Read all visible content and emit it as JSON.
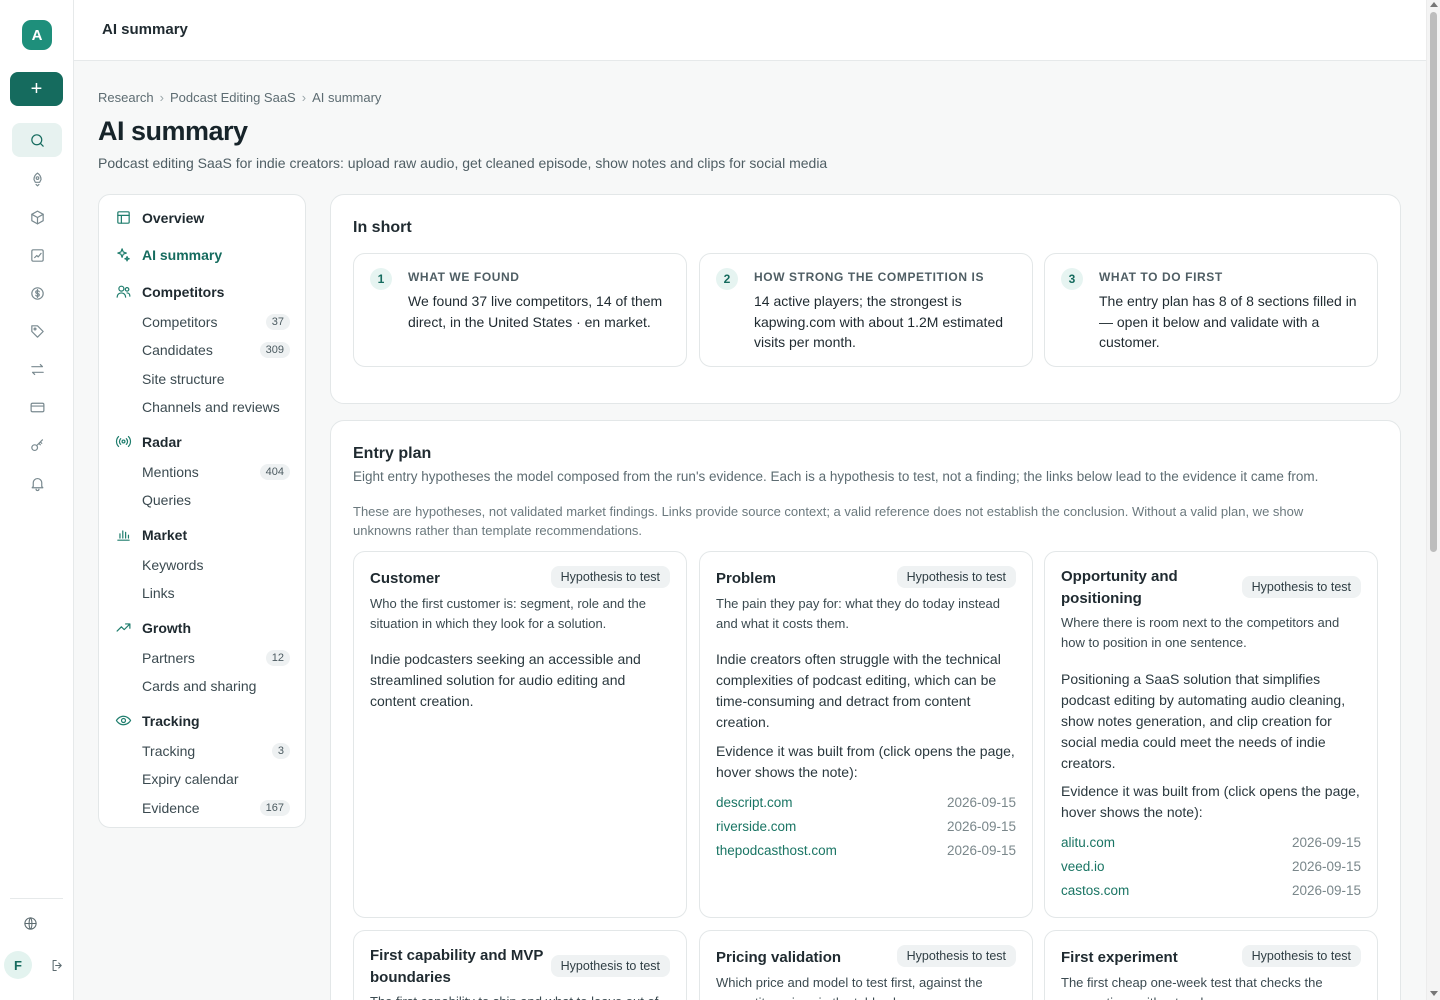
{
  "rail": {
    "avatar_letter": "A",
    "new_label": "+",
    "user_letter": "F",
    "icons": [
      "search-icon",
      "rocket-icon",
      "box-icon",
      "chart-check-icon",
      "currency-icon",
      "tag-icon",
      "swap-icon",
      "card-icon",
      "key-icon",
      "bell-icon"
    ]
  },
  "topbar": {
    "title": "AI summary"
  },
  "breadcrumb": [
    "Research",
    "Podcast Editing SaaS",
    "AI summary"
  ],
  "page": {
    "title": "AI summary",
    "subtitle": "Podcast editing SaaS for indie creators: upload raw audio, get cleaned episode, show notes and clips for social media"
  },
  "nav": {
    "overview": "Overview",
    "ai_summary": "AI summary",
    "competitors": {
      "label": "Competitors",
      "items": [
        {
          "label": "Competitors",
          "count": "37"
        },
        {
          "label": "Candidates",
          "count": "309"
        },
        {
          "label": "Site structure",
          "count": ""
        },
        {
          "label": "Channels and reviews",
          "count": ""
        }
      ]
    },
    "radar": {
      "label": "Radar",
      "items": [
        {
          "label": "Mentions",
          "count": "404"
        },
        {
          "label": "Queries",
          "count": ""
        }
      ]
    },
    "market": {
      "label": "Market",
      "items": [
        {
          "label": "Keywords",
          "count": ""
        },
        {
          "label": "Links",
          "count": ""
        }
      ]
    },
    "growth": {
      "label": "Growth",
      "items": [
        {
          "label": "Partners",
          "count": "12"
        },
        {
          "label": "Cards and sharing",
          "count": ""
        }
      ]
    },
    "tracking": {
      "label": "Tracking",
      "items": [
        {
          "label": "Tracking",
          "count": "3"
        },
        {
          "label": "Expiry calendar",
          "count": ""
        },
        {
          "label": "Evidence",
          "count": "167"
        }
      ]
    }
  },
  "in_short": {
    "title": "In short",
    "items": [
      {
        "num": "1",
        "caption": "WHAT WE FOUND",
        "text": "We found 37 live competitors, 14 of them direct, in the United States · en market."
      },
      {
        "num": "2",
        "caption": "HOW STRONG THE COMPETITION IS",
        "text": "14 active players; the strongest is kapwing.com with about 1.2M estimated visits per month."
      },
      {
        "num": "3",
        "caption": "WHAT TO DO FIRST",
        "text": "The entry plan has 8 of 8 sections filled in — open it below and validate with a customer."
      }
    ]
  },
  "entry_plan": {
    "title": "Entry plan",
    "description": "Eight entry hypotheses the model composed from the run's evidence. Each is a hypothesis to test, not a finding; the links below lead to the evidence it came from.",
    "note": "These are hypotheses, not validated market findings. Links provide source context; a valid reference does not establish the conclusion. Without a valid plan, we show unknowns rather than template recommendations.",
    "badge": "Hypothesis to test",
    "evidence_label": "Evidence it was built from (click opens the page, hover shows the note):",
    "cards": [
      {
        "title": "Customer",
        "question": "Who the first customer is: segment, role and the situation in which they look for a solution.",
        "answer": "Indie podcasters seeking an accessible and streamlined solution for audio editing and content creation.",
        "sources": []
      },
      {
        "title": "Problem",
        "question": "The pain they pay for: what they do today instead and what it costs them.",
        "answer": "Indie creators often struggle with the technical complexities of podcast editing, which can be time-consuming and detract from content creation.",
        "sources": [
          {
            "domain": "descript.com",
            "date": "2026-09-15"
          },
          {
            "domain": "riverside.com",
            "date": "2026-09-15"
          },
          {
            "domain": "thepodcasthost.com",
            "date": "2026-09-15"
          }
        ]
      },
      {
        "title": "Opportunity and positioning",
        "question": "Where there is room next to the competitors and how to position in one sentence.",
        "answer": "Positioning a SaaS solution that simplifies podcast editing by automating audio cleaning, show notes generation, and clip creation for social media could meet the needs of indie creators.",
        "sources": [
          {
            "domain": "alitu.com",
            "date": "2026-09-15"
          },
          {
            "domain": "veed.io",
            "date": "2026-09-15"
          },
          {
            "domain": "castos.com",
            "date": "2026-09-15"
          }
        ]
      },
      {
        "title": "First capability and MVP boundaries",
        "question": "The first capability to ship and what to leave out of",
        "answer": "",
        "sources": []
      },
      {
        "title": "Pricing validation",
        "question": "Which price and model to test first, against the competitor prices in the table above.",
        "answer": "",
        "sources": []
      },
      {
        "title": "First experiment",
        "question": "The first cheap one-week test that checks the assumptions without code.",
        "answer": "",
        "sources": []
      }
    ]
  }
}
